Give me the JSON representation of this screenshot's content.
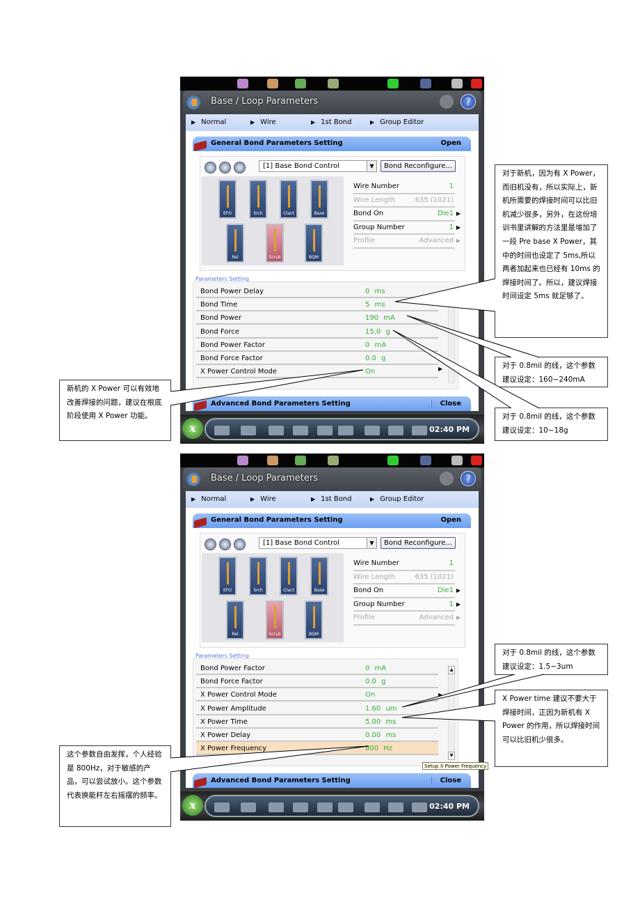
{
  "screens": [
    {
      "title": "Base / Loop Parameters",
      "nav": [
        "Normal",
        "Wire",
        "1st Bond",
        "Group Editor"
      ],
      "general_header": "General Bond Parameters Setting",
      "general_action": "Open",
      "bond_select": "[1] Base Bond Control",
      "reconfigure_button": "Bond Reconfigure...",
      "tiles": [
        "EFO",
        "Srch",
        "Ctact",
        "Base",
        "Rel",
        "Scrub",
        "BQM"
      ],
      "info": [
        {
          "label": "Wire Number",
          "value": "1",
          "disabled": false
        },
        {
          "label": "Wire Length",
          "value": "635 (1021)",
          "disabled": true
        },
        {
          "label": "Bond On",
          "value": "Die1",
          "disabled": false
        },
        {
          "label": "Group Number",
          "value": "1",
          "disabled": false
        },
        {
          "label": "Profile",
          "value": "Advanced",
          "disabled": true
        }
      ],
      "params_label": "Parameters Setting",
      "params": [
        {
          "label": "Bond Power Delay",
          "value": "0 ms"
        },
        {
          "label": "Bond Time",
          "value": "5 ms"
        },
        {
          "label": "Bond Power",
          "value": "190 mA"
        },
        {
          "label": "Bond Force",
          "value": "15.0 g"
        },
        {
          "label": "Bond Power Factor",
          "value": "0 mA"
        },
        {
          "label": "Bond Force Factor",
          "value": "0.0 g"
        },
        {
          "label": "X Power Control Mode",
          "value": "On"
        }
      ],
      "highlight_row": -1,
      "advanced_header": "Advanced Bond Parameters Setting",
      "advanced_action": "Close",
      "time": "02:40 PM"
    },
    {
      "title": "Base / Loop Parameters",
      "nav": [
        "Normal",
        "Wire",
        "1st Bond",
        "Group Editor"
      ],
      "general_header": "General Bond Parameters Setting",
      "general_action": "Open",
      "bond_select": "[1] Base Bond Control",
      "reconfigure_button": "Bond Reconfigure...",
      "tiles": [
        "EFO",
        "Srch",
        "Ctact",
        "Base",
        "Rel",
        "Scrub",
        "BQM"
      ],
      "info": [
        {
          "label": "Wire Number",
          "value": "1",
          "disabled": false
        },
        {
          "label": "Wire Length",
          "value": "635 (1021)",
          "disabled": true
        },
        {
          "label": "Bond On",
          "value": "Die1",
          "disabled": false
        },
        {
          "label": "Group Number",
          "value": "1",
          "disabled": false
        },
        {
          "label": "Profile",
          "value": "Advanced",
          "disabled": true
        }
      ],
      "params_label": "Parameters Setting",
      "params": [
        {
          "label": "Bond Power Factor",
          "value": "0 mA"
        },
        {
          "label": "Bond Force Factor",
          "value": "0.0 g"
        },
        {
          "label": "X Power Control Mode",
          "value": "On"
        },
        {
          "label": "X Power Amplitude",
          "value": "1.60 um"
        },
        {
          "label": "X Power Time",
          "value": "5.00 ms"
        },
        {
          "label": "X Power Delay",
          "value": "0.00 ms"
        },
        {
          "label": "X Power Frequency",
          "value": "800 Hz"
        }
      ],
      "highlight_row": 6,
      "advanced_header": "Advanced Bond Parameters Setting",
      "advanced_action": "Close",
      "time": "02:40 PM",
      "tooltip": "Setup X Power Frequency"
    }
  ],
  "notes": [
    "对于新机，因为有 X Power，而旧机没有，所以实际上，新机所需要的焊接时间可以比旧机减少很多，另外，在这份培训书里讲解的方法里是增加了一段 Pre base X Power，其中的时间也设定了 5ms,所以两者加起来也已经有 10ms 的焊接时间了。所以，建议焊接时间设定 5ms 就足够了。",
    "对于 0.8mil 的线，这个参数建议设定：160~240mA",
    "对于 0.8mil 的线，这个参数建议设定：10~18g",
    "新机的 X Power 可以有效地改善焊接的问题，建议在根底阶段使用 X Power 功能。",
    "对于 0.8mil 的线，这个参数建议设定：1.5~3um",
    "X Power time 建议不要大于焊接时间，正因为新机有 X Power 的作用，所以焊接时间可以比旧机少很多。",
    "这个参数自由发挥，个人经验是 800Hz，对于敏感的产品，可以尝试放小。这个参数代表换能杆左右摇摆的频率。"
  ],
  "colors": {
    "value_green": "#3aaa3a",
    "panel_blue": "#7aaaf2",
    "highlight": "#f8e0c0"
  }
}
